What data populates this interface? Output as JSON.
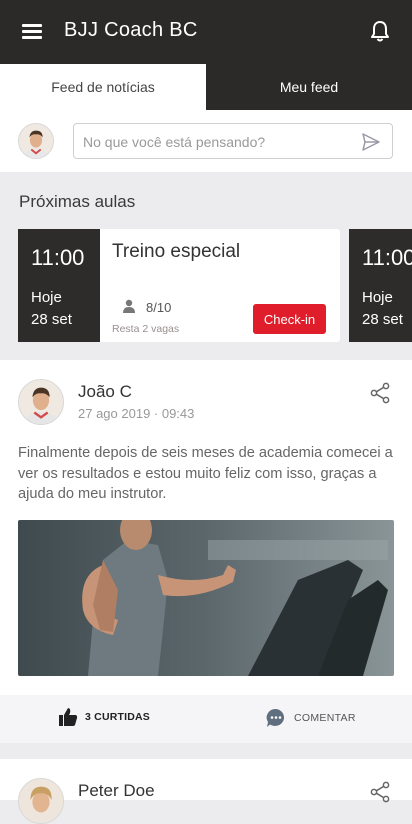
{
  "app": {
    "title": "BJJ Coach BC"
  },
  "tabs": [
    {
      "label": "Feed de notícias",
      "active": true
    },
    {
      "label": "Meu feed",
      "active": false
    }
  ],
  "composer": {
    "placeholder": "No que você está pensando?"
  },
  "classes": {
    "heading": "Próximas aulas",
    "cards": [
      {
        "hour": "11:00",
        "day": "Hoje",
        "date": "28 set",
        "name": "Treino especial",
        "count": "8/10",
        "vagas": "Resta 2 vagas",
        "checkin": "Check-in"
      },
      {
        "hour": "11:00",
        "day": "Hoje",
        "date": "28 set"
      }
    ]
  },
  "posts": [
    {
      "author": "João C",
      "time": "27 ago 2019 · 09:43",
      "body": "Finalmente depois de seis meses de academia comecei a ver os resultados e estou muito feliz com isso, graças a ajuda do meu instrutor.",
      "likes_label": "3 CURTIDAS",
      "comment_label": "COMENTAR"
    },
    {
      "author": "Peter Doe"
    }
  ],
  "colors": {
    "appbar": "#2b2a28",
    "checkin": "#e01e2b",
    "background": "#ececee"
  },
  "icons": [
    "menu-icon",
    "bell-icon",
    "send-icon",
    "person-icon",
    "share-icon",
    "thumbs-up-icon",
    "comment-icon"
  ]
}
